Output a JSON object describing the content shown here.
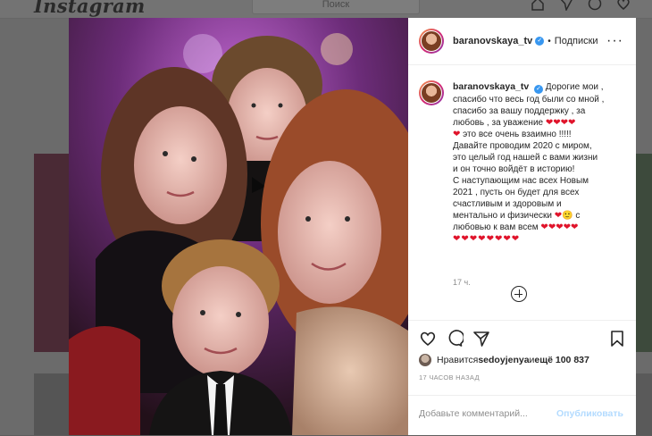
{
  "app": {
    "logo": "Instagram",
    "search_placeholder": "Поиск"
  },
  "post": {
    "username": "baranovskaya_tv",
    "follow_label": "Подписки",
    "caption_lines": [
      "Дорогие мои ,",
      "спасибо что весь год были со мной ,",
      "спасибо за вашу поддержку , за",
      "любовь , за уважение ❤❤❤❤",
      "❤ это все очень взаимно !!!!!",
      "Давайте проводим 2020 с миром,",
      "это целый год нашей с вами жизни",
      "и он точно войдёт в историю!",
      "С наступающим нас всех Новым",
      "2021 , пусть он будет для всех",
      "счастливым и здоровым и",
      "ментально и физически ❤🙂 с",
      "любовью к вам всем ❤❤❤❤❤",
      "❤❤❤❤❤❤❤❤"
    ],
    "caption_time": "17 ч.",
    "liked_by_prefix": "Нравится ",
    "liked_by_user": "sedoyjenya",
    "liked_by_and": " и ",
    "liked_by_count": "ещё 100 837",
    "date_label": "17 ЧАСОВ НАЗАД",
    "comment_placeholder": "Добавьте комментарий...",
    "post_button": "Опубликовать"
  },
  "icons": {
    "like": "heart-icon",
    "comment": "comment-icon",
    "share": "share-icon",
    "save": "bookmark-icon",
    "more": "more-icon",
    "load_more": "plus-circle-icon"
  },
  "colors": {
    "accent_blue": "#3897f0",
    "heart_red": "#e0142b",
    "muted_text": "#8e8e8e"
  }
}
